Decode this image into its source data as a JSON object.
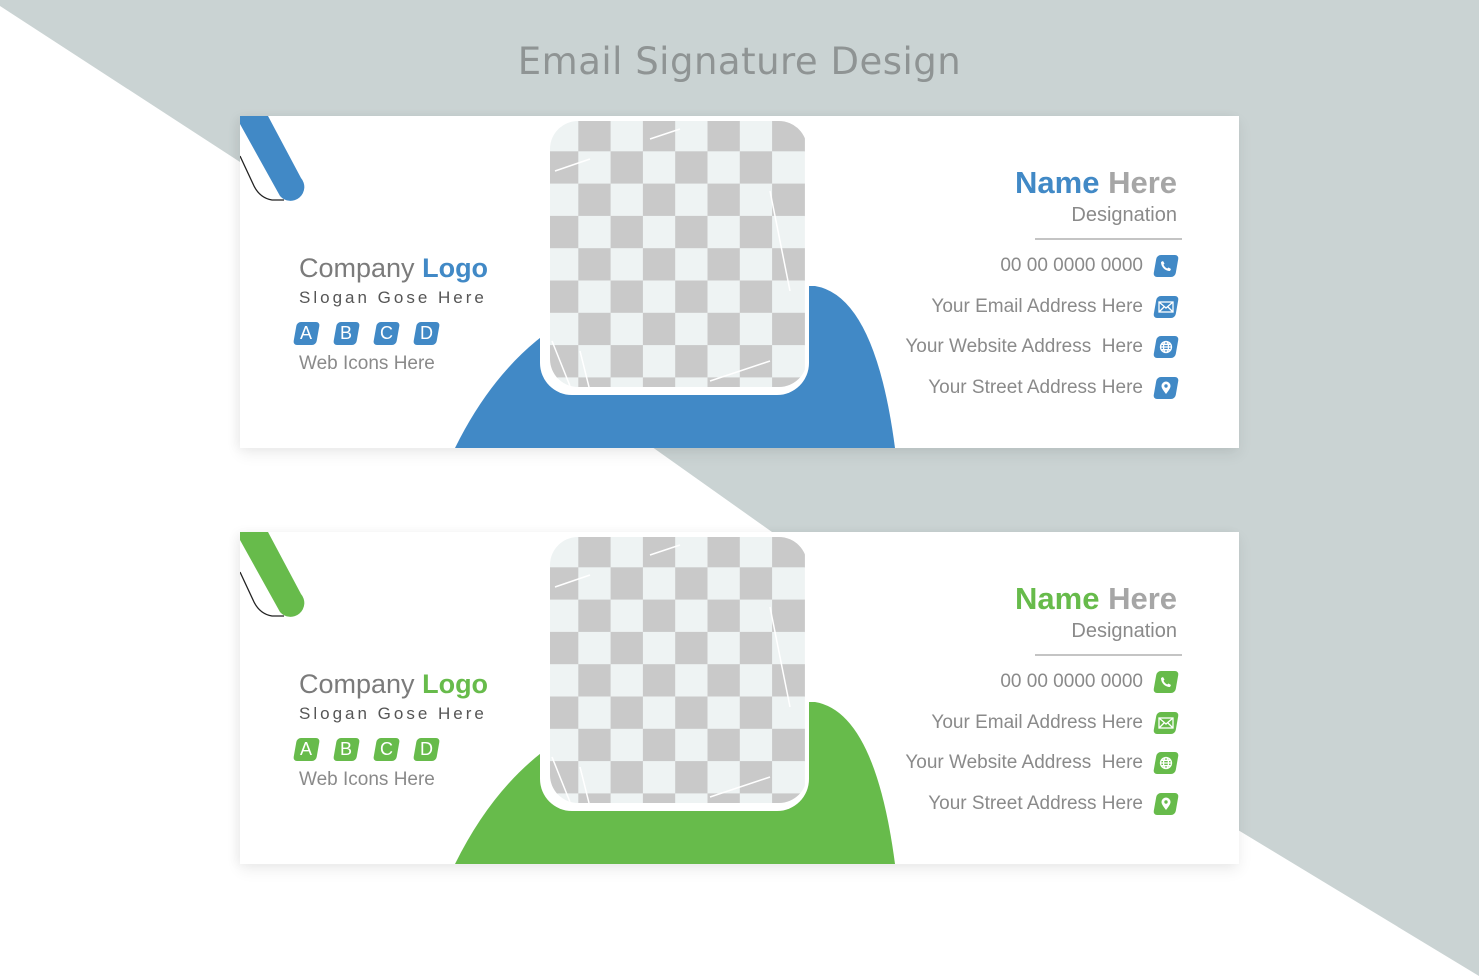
{
  "page": {
    "title": "Email Signature Design",
    "background_color": "#cad3d3"
  },
  "cards": [
    {
      "accent": "#4189c6",
      "company": {
        "word1": "Company",
        "word2": "Logo"
      },
      "slogan": "Slogan Gose Here",
      "badges": [
        "A",
        "B",
        "C",
        "D"
      ],
      "web_icons_label": "Web Icons Here",
      "name": {
        "first": "Name",
        "second": "Here"
      },
      "designation": "Designation",
      "contacts": [
        {
          "icon": "phone-icon",
          "text": "00 00 0000 0000"
        },
        {
          "icon": "email-icon",
          "text": "Your Email Address Here"
        },
        {
          "icon": "globe-icon",
          "text": "Your Website Address  Here"
        },
        {
          "icon": "location-pin-icon",
          "text": "Your Street Address Here"
        }
      ]
    },
    {
      "accent": "#67bb4b",
      "company": {
        "word1": "Company",
        "word2": "Logo"
      },
      "slogan": "Slogan Gose Here",
      "badges": [
        "A",
        "B",
        "C",
        "D"
      ],
      "web_icons_label": "Web Icons Here",
      "name": {
        "first": "Name",
        "second": "Here"
      },
      "designation": "Designation",
      "contacts": [
        {
          "icon": "phone-icon",
          "text": "00 00 0000 0000"
        },
        {
          "icon": "email-icon",
          "text": "Your Email Address Here"
        },
        {
          "icon": "globe-icon",
          "text": "Your Website Address  Here"
        },
        {
          "icon": "location-pin-icon",
          "text": "Your Street Address Here"
        }
      ]
    }
  ]
}
